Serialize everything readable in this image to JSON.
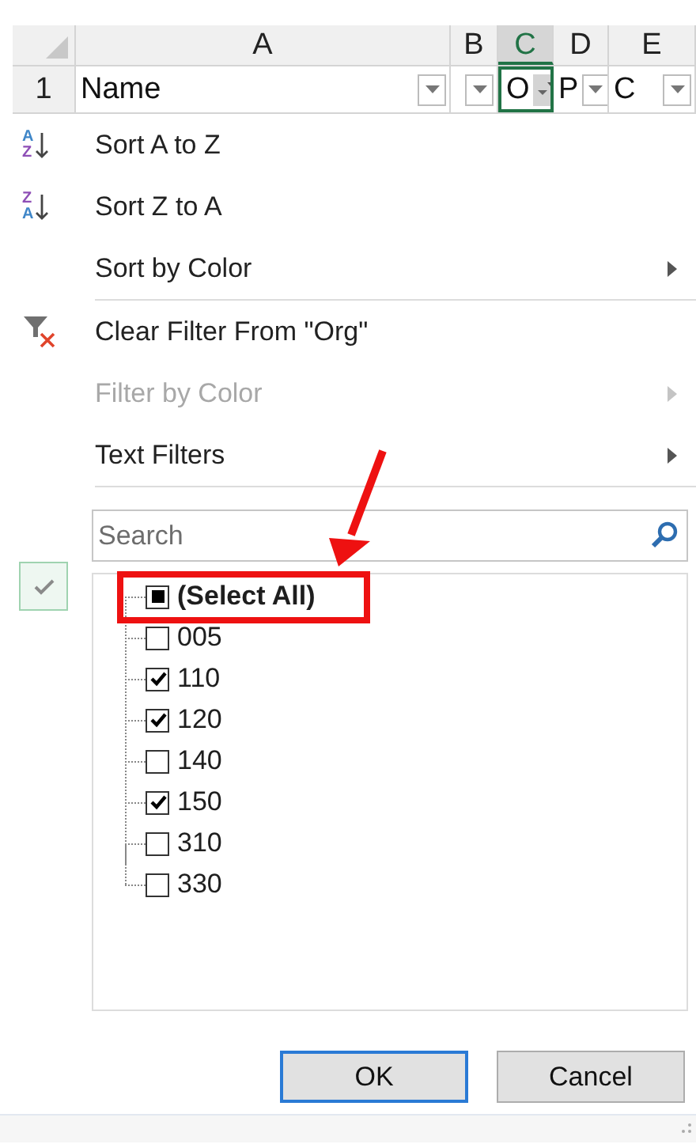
{
  "sheet": {
    "columns": [
      {
        "label": "A",
        "selected": false
      },
      {
        "label": "B",
        "selected": false
      },
      {
        "label": "C",
        "selected": true
      },
      {
        "label": "D",
        "selected": false
      },
      {
        "label": "E",
        "selected": false
      }
    ],
    "row": {
      "number": "1",
      "cells": [
        {
          "text": "Name",
          "kind": "dropdown"
        },
        {
          "kind": "dropdown"
        },
        {
          "text": "O",
          "kind": "filtered"
        },
        {
          "text": "P",
          "kind": "dropdown"
        },
        {
          "text": "C",
          "kind": "dropdown"
        }
      ]
    }
  },
  "menu": {
    "items": [
      {
        "kind": "sort",
        "icon_letters": [
          "A",
          "Z"
        ],
        "label": "Sort A to Z",
        "disabled": false,
        "submenu": false
      },
      {
        "kind": "sort",
        "icon_letters": [
          "Z",
          "A"
        ],
        "label": "Sort Z to A",
        "disabled": false,
        "submenu": false
      },
      {
        "kind": "command",
        "label": "Sort by Color",
        "disabled": false,
        "submenu": true
      },
      {
        "kind": "separator"
      },
      {
        "kind": "clear",
        "label": "Clear Filter From \"Org\"",
        "disabled": false,
        "submenu": false
      },
      {
        "kind": "command",
        "label": "Filter by Color",
        "disabled": true,
        "submenu": true
      },
      {
        "kind": "command",
        "label": "Text Filters",
        "disabled": false,
        "submenu": true
      },
      {
        "kind": "separator"
      }
    ]
  },
  "search": {
    "placeholder": "Search"
  },
  "filter_list": {
    "select_all": {
      "label": "(Select All)",
      "checked": false,
      "indeterminate": true
    },
    "values": [
      {
        "label": "005",
        "checked": false
      },
      {
        "label": "110",
        "checked": true
      },
      {
        "label": "120",
        "checked": true
      },
      {
        "label": "140",
        "checked": false
      },
      {
        "label": "150",
        "checked": true
      },
      {
        "label": "310",
        "checked": false
      },
      {
        "label": "330",
        "checked": false
      }
    ]
  },
  "buttons": [
    {
      "label": "OK",
      "default": true
    },
    {
      "label": "Cancel",
      "default": false
    }
  ],
  "annotations": [
    {
      "kind": "arrow"
    },
    {
      "kind": "box"
    }
  ]
}
